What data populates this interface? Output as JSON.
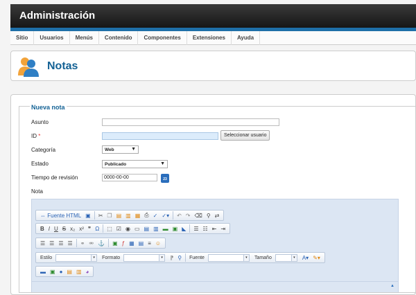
{
  "header": {
    "title": "Administración"
  },
  "menu": {
    "items": [
      "Sitio",
      "Usuarios",
      "Menús",
      "Contenido",
      "Componentes",
      "Extensiones",
      "Ayuda"
    ]
  },
  "page": {
    "title": "Notas",
    "icon": "users-icon"
  },
  "form": {
    "legend": "Nueva nota",
    "asunto_label": "Asunto",
    "asunto_value": "",
    "id_label": "ID",
    "id_required": "*",
    "id_value": "",
    "select_user_button": "Seleccionar usuario",
    "categoria_label": "Categoría",
    "categoria_value": "Web",
    "estado_label": "Estado",
    "estado_value": "Publicado",
    "tiempo_label": "Tiempo de revisión",
    "tiempo_value": "0000-00-00",
    "nota_label": "Nota"
  },
  "editor": {
    "source_label": "Fuente HTML",
    "estilo_label": "Estilo",
    "formato_label": "Formato",
    "fuente_label": "Fuente",
    "tamano_label": "Tamaño"
  },
  "colors": {
    "accent": "#146295",
    "menubar": "#1e6fa8",
    "editor_bg": "#dce6f3"
  }
}
